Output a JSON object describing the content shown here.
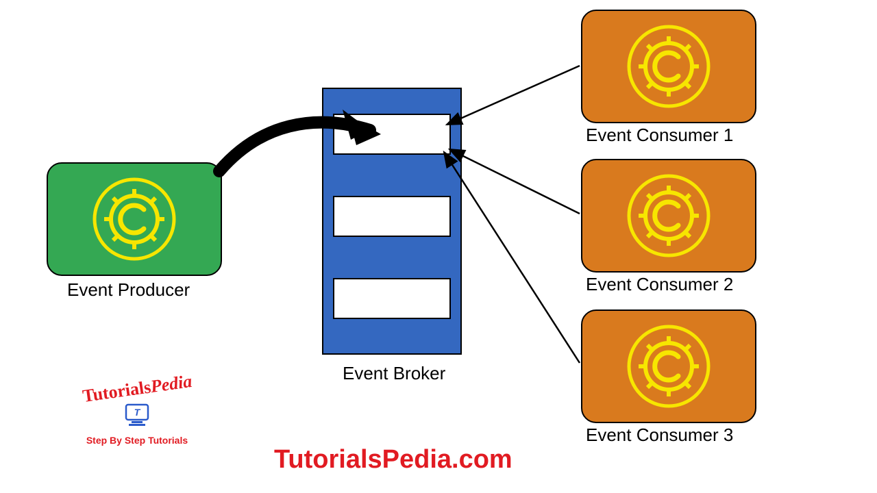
{
  "colors": {
    "producer_fill": "#34a853",
    "consumer_fill": "#d97a1e",
    "broker_fill": "#3468c0",
    "accent_yellow": "#f7e600",
    "stroke_black": "#000000",
    "brand_red": "#e11b22"
  },
  "producer": {
    "label": "Event Producer"
  },
  "broker": {
    "label": "Event Broker"
  },
  "consumers": [
    {
      "label": "Event Consumer 1"
    },
    {
      "label": "Event Consumer 2"
    },
    {
      "label": "Event Consumer 3"
    }
  ],
  "site": {
    "url_text": "TutorialsPedia.com"
  },
  "logo": {
    "word1": "Tutorials",
    "word2": "Pedia",
    "tagline": "Step By Step Tutorials"
  }
}
